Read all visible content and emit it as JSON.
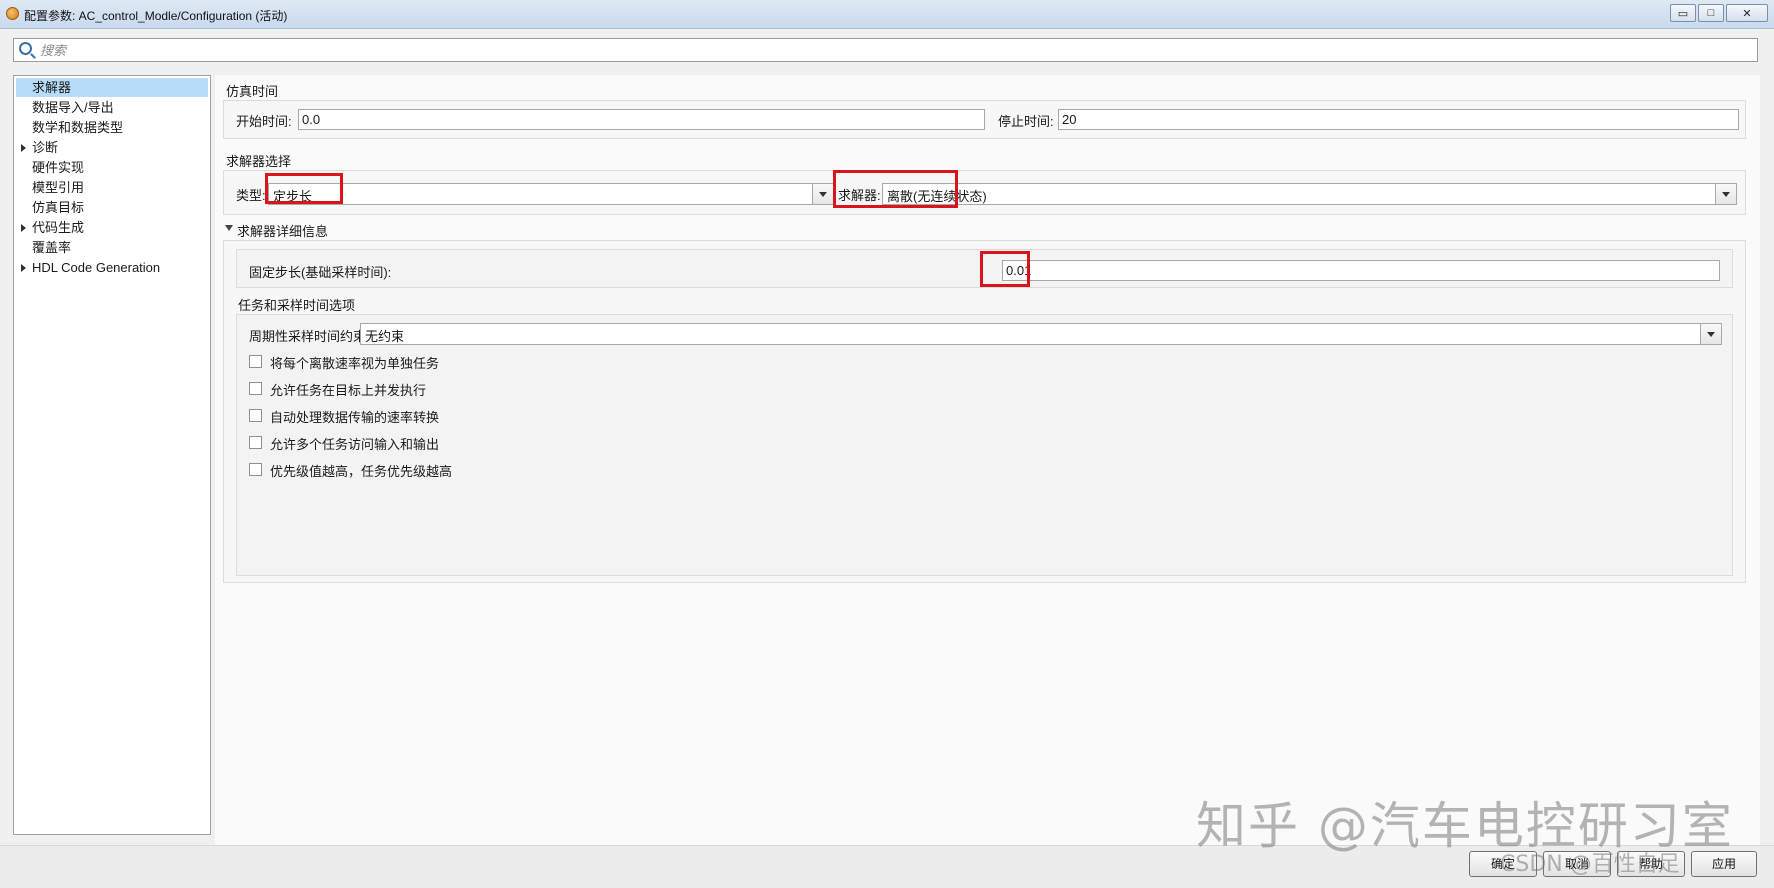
{
  "window": {
    "title": "配置参数: AC_control_Modle/Configuration (活动)",
    "minimize": "▭",
    "maximize": "□",
    "close": "✕"
  },
  "search": {
    "placeholder": "搜索"
  },
  "tree": {
    "items": [
      {
        "label": "求解器",
        "selected": true,
        "expandable": false
      },
      {
        "label": "数据导入/导出",
        "selected": false,
        "expandable": false
      },
      {
        "label": "数学和数据类型",
        "selected": false,
        "expandable": false
      },
      {
        "label": "诊断",
        "selected": false,
        "expandable": true
      },
      {
        "label": "硬件实现",
        "selected": false,
        "expandable": false
      },
      {
        "label": "模型引用",
        "selected": false,
        "expandable": false
      },
      {
        "label": "仿真目标",
        "selected": false,
        "expandable": false
      },
      {
        "label": "代码生成",
        "selected": false,
        "expandable": true
      },
      {
        "label": "覆盖率",
        "selected": false,
        "expandable": false
      },
      {
        "label": "HDL Code Generation",
        "selected": false,
        "expandable": true
      }
    ]
  },
  "sim_time": {
    "heading": "仿真时间",
    "start_label": "开始时间:",
    "start_value": "0.0",
    "stop_label": "停止时间:",
    "stop_value": "20"
  },
  "solver_selection": {
    "heading": "求解器选择",
    "type_label": "类型:",
    "type_value": "定步长",
    "solver_label": "求解器:",
    "solver_value": "离散(无连续状态)"
  },
  "solver_details": {
    "heading": "求解器详细信息",
    "fixed_step_label": "固定步长(基础采样时间):",
    "fixed_step_value": "0.01"
  },
  "tasking": {
    "heading": "任务和采样时间选项",
    "periodic_label": "周期性采样时间约束:",
    "periodic_value": "无约束",
    "options": [
      {
        "label": "将每个离散速率视为单独任务",
        "checked": false
      },
      {
        "label": "允许任务在目标上并发执行",
        "checked": false
      },
      {
        "label": "自动处理数据传输的速率转换",
        "checked": false
      },
      {
        "label": "允许多个任务访问输入和输出",
        "checked": false
      },
      {
        "label": "优先级值越高，任务优先级越高",
        "checked": false
      }
    ]
  },
  "buttons": {
    "ok": "确定",
    "cancel": "取消",
    "help": "帮助",
    "apply": "应用"
  },
  "watermark": {
    "zhihu": "知乎 @汽车电控研习室",
    "csdn": "CSDN @百性自足"
  },
  "colors": {
    "highlight_box": "#d9141b",
    "selection": "#b6dcfa"
  }
}
